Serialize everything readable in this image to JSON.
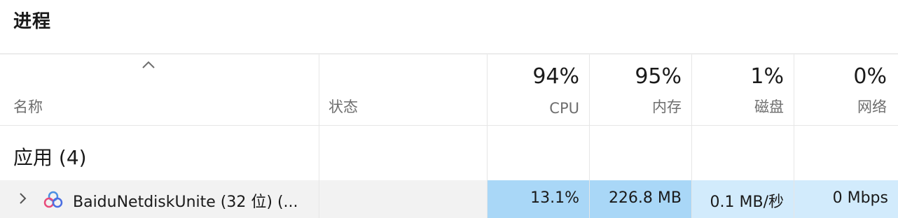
{
  "page": {
    "title": "进程"
  },
  "columns": {
    "name": {
      "label": "名称"
    },
    "status": {
      "label": "状态"
    },
    "cpu": {
      "percent": "94%",
      "label": "CPU"
    },
    "memory": {
      "percent": "95%",
      "label": "内存"
    },
    "disk": {
      "percent": "1%",
      "label": "磁盘"
    },
    "network": {
      "percent": "0%",
      "label": "网络"
    }
  },
  "groups": [
    {
      "label": "应用 (4)"
    }
  ],
  "processes": [
    {
      "name": "BaiduNetdiskUnite (32 位) (...",
      "status": "",
      "cpu": "13.1%",
      "memory": "226.8 MB",
      "disk": "0.1 MB/秒",
      "network": "0 Mbps"
    }
  ],
  "colors": {
    "heat_strong": "#a9d7f7",
    "heat_light": "#d2ebfc",
    "row_hover": "#f2f2f2",
    "grid_line": "#e6e6e6"
  },
  "icons": {
    "sort": "chevron-up-icon",
    "expand": "chevron-right-icon",
    "app": "baidu-netdisk-app-icon"
  }
}
